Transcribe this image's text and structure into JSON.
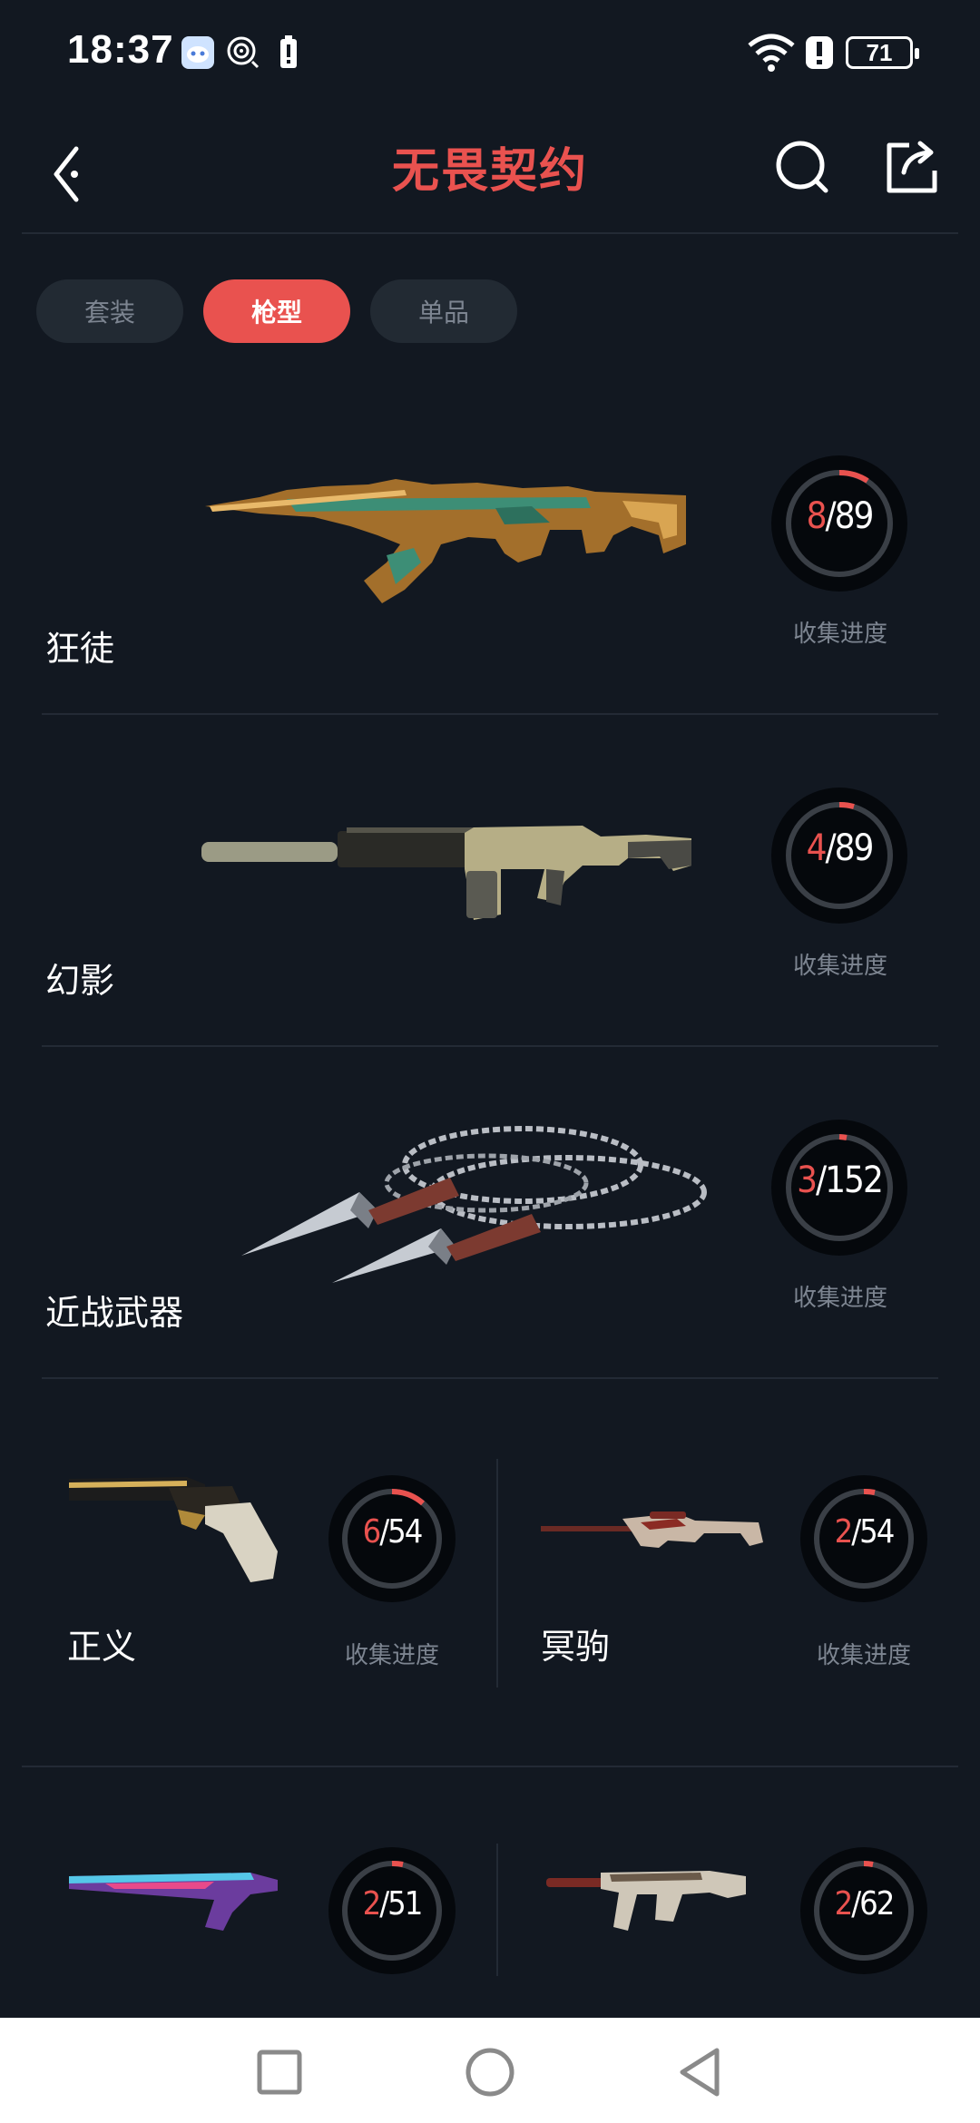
{
  "status_bar": {
    "time": "18:37",
    "battery": "71"
  },
  "header": {
    "title": "无畏契约"
  },
  "tabs": [
    {
      "label": "套装",
      "active": false
    },
    {
      "label": "枪型",
      "active": true
    },
    {
      "label": "单品",
      "active": false
    }
  ],
  "weapons_full": [
    {
      "name": "狂徒",
      "collected": "8",
      "total": "/89",
      "progress_label": "收集进度"
    },
    {
      "name": "幻影",
      "collected": "4",
      "total": "/89",
      "progress_label": "收集进度"
    },
    {
      "name": "近战武器",
      "collected": "3",
      "total": "/152",
      "progress_label": "收集进度"
    }
  ],
  "weapons_half": [
    {
      "name": "正义",
      "collected": "6",
      "total": "/54",
      "progress_label": "收集进度"
    },
    {
      "name": "冥驹",
      "collected": "2",
      "total": "/54",
      "progress_label": "收集进度"
    },
    {
      "name": "",
      "collected": "2",
      "total": "/51"
    },
    {
      "name": "",
      "collected": "2",
      "total": "/62"
    }
  ],
  "colors": {
    "accent": "#e9524f",
    "background": "#121821",
    "ring_track": "#3a3f46"
  },
  "icons": [
    "back-icon",
    "search-icon",
    "share-icon",
    "square-nav-icon",
    "home-nav-icon",
    "back-nav-icon"
  ]
}
